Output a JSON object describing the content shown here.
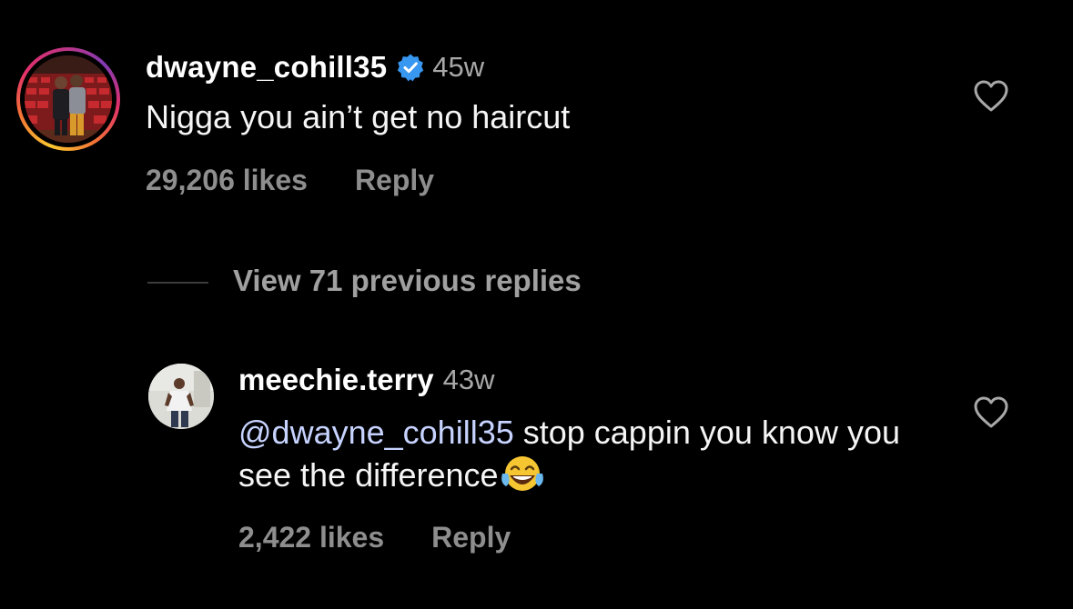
{
  "comments": [
    {
      "username": "dwayne_cohill35",
      "verified": true,
      "time": "45w",
      "text": "Nigga you ain’t get no haircut",
      "likes": "29,206 likes",
      "reply_label": "Reply",
      "avatar": "profile-photo-with-story-ring",
      "icons": {
        "verified": "verified-badge-icon",
        "like": "heart-outline-icon"
      }
    },
    {
      "username": "meechie.terry",
      "verified": false,
      "time": "43w",
      "mention": "@dwayne_cohill35",
      "text": " stop cappin you know you see the difference",
      "emoji": "😂",
      "likes": "2,422 likes",
      "reply_label": "Reply",
      "avatar": "profile-photo",
      "icons": {
        "like": "heart-outline-icon",
        "emoji": "tears-of-joy-emoji"
      }
    }
  ],
  "view_replies": "View 71 previous replies",
  "colors": {
    "background": "#000000",
    "primary_text": "#f5f5f5",
    "secondary_text": "#8e8e8e",
    "mention": "#c7d3ff",
    "verified": "#3897f0"
  }
}
